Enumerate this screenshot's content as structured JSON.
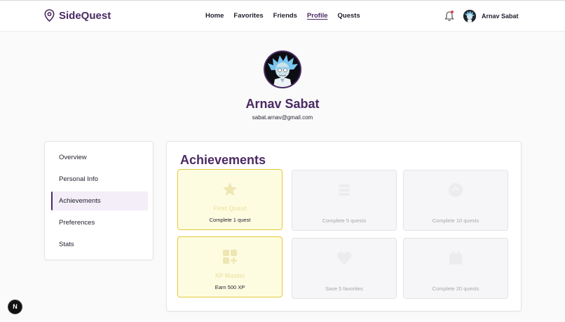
{
  "app": {
    "brand": "SideQuest"
  },
  "nav": {
    "items": [
      {
        "label": "Home"
      },
      {
        "label": "Favorites"
      },
      {
        "label": "Friends"
      },
      {
        "label": "Profile"
      },
      {
        "label": "Quests"
      }
    ],
    "active": "Profile"
  },
  "user": {
    "name": "Arnav Sabat",
    "has_notification": true
  },
  "profile": {
    "name": "Arnav Sabat",
    "email": "sabat.arnav@gmail.com"
  },
  "sidebar": {
    "items": [
      {
        "label": "Overview"
      },
      {
        "label": "Personal Info"
      },
      {
        "label": "Achievements"
      },
      {
        "label": "Preferences"
      },
      {
        "label": "Stats"
      }
    ],
    "active": "Achievements"
  },
  "achievements": {
    "title": "Achievements",
    "cards": [
      {
        "title": "First Quest",
        "desc": "Complete 1 quest",
        "unlocked": true,
        "icon": "star-icon"
      },
      {
        "title": "",
        "desc": "Complete 5 quests",
        "unlocked": false,
        "icon": "stack-icon"
      },
      {
        "title": "",
        "desc": "Complete 10 quests",
        "unlocked": false,
        "icon": "compass-icon"
      },
      {
        "title": "XP Master",
        "desc": "Earn 500 XP",
        "unlocked": true,
        "icon": "grid-plus-icon"
      },
      {
        "title": "",
        "desc": "Save 5 favorites",
        "unlocked": false,
        "icon": "heart-icon"
      },
      {
        "title": "",
        "desc": "Complete 20 quests",
        "unlocked": false,
        "icon": "calendar-icon"
      }
    ]
  },
  "dev_badge": {
    "label": "N"
  },
  "colors": {
    "brand": "#4b2a63",
    "unlocked_bg": "#fefce0",
    "unlocked_border": "#e3c93a",
    "locked_bg": "#f6f6f8"
  }
}
